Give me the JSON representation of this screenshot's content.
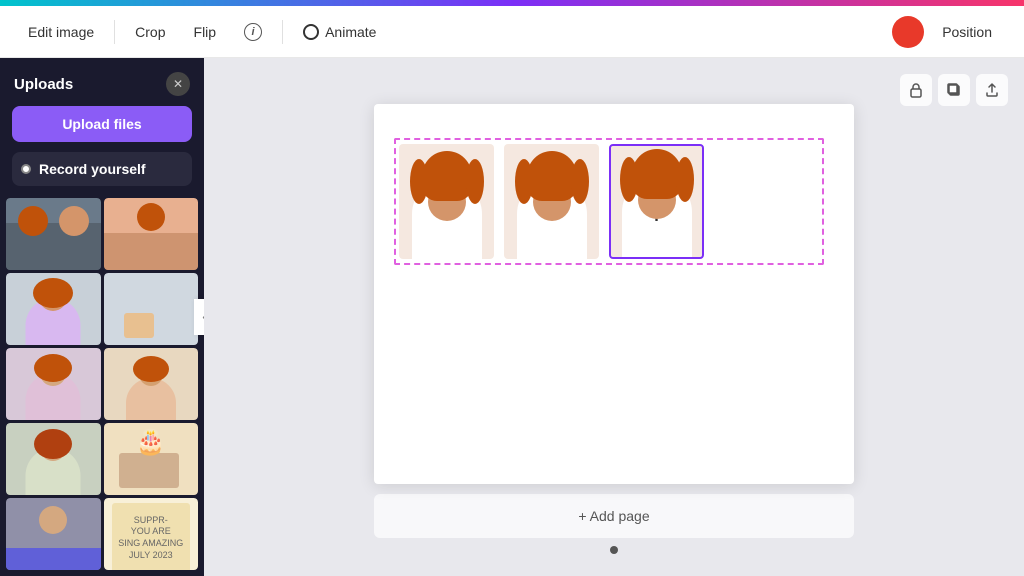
{
  "topbar": {
    "gradient": "linear-gradient(90deg, #00c4cc, #7b2ff7, #f7346a)"
  },
  "header": {
    "edit_image_label": "Edit image",
    "crop_label": "Crop",
    "flip_label": "Flip",
    "animate_label": "Animate",
    "position_label": "Position"
  },
  "sidebar": {
    "title": "Uploads",
    "upload_btn_label": "Upload files",
    "record_btn_label": "Record yourself",
    "collapse_icon": "‹",
    "photos": [
      {
        "id": 1,
        "color": "sp1",
        "desc": "woman in workshop"
      },
      {
        "id": 2,
        "color": "sp2",
        "desc": "woman gesturing"
      },
      {
        "id": 3,
        "color": "sp3",
        "desc": "woman pink sweater"
      },
      {
        "id": 4,
        "color": "sp4",
        "desc": "hands crafting"
      },
      {
        "id": 5,
        "color": "sp5",
        "desc": "woman writing"
      },
      {
        "id": 6,
        "color": "sp6",
        "desc": "woman with cake"
      },
      {
        "id": 7,
        "color": "sp7",
        "desc": "woman in pink"
      },
      {
        "id": 8,
        "color": "sp8",
        "desc": "woman baking"
      },
      {
        "id": 9,
        "color": "sp9",
        "desc": "woman pink top"
      },
      {
        "id": 10,
        "color": "sp10",
        "desc": "sign board"
      }
    ]
  },
  "canvas": {
    "toolbar_icons": [
      "lock-icon",
      "copy-icon",
      "share-icon"
    ],
    "portraits": [
      {
        "id": 1,
        "selected": false,
        "label": "portrait-1"
      },
      {
        "id": 2,
        "selected": false,
        "label": "portrait-2"
      },
      {
        "id": 3,
        "selected": true,
        "label": "portrait-3"
      }
    ],
    "add_page_label": "+ Add page"
  }
}
